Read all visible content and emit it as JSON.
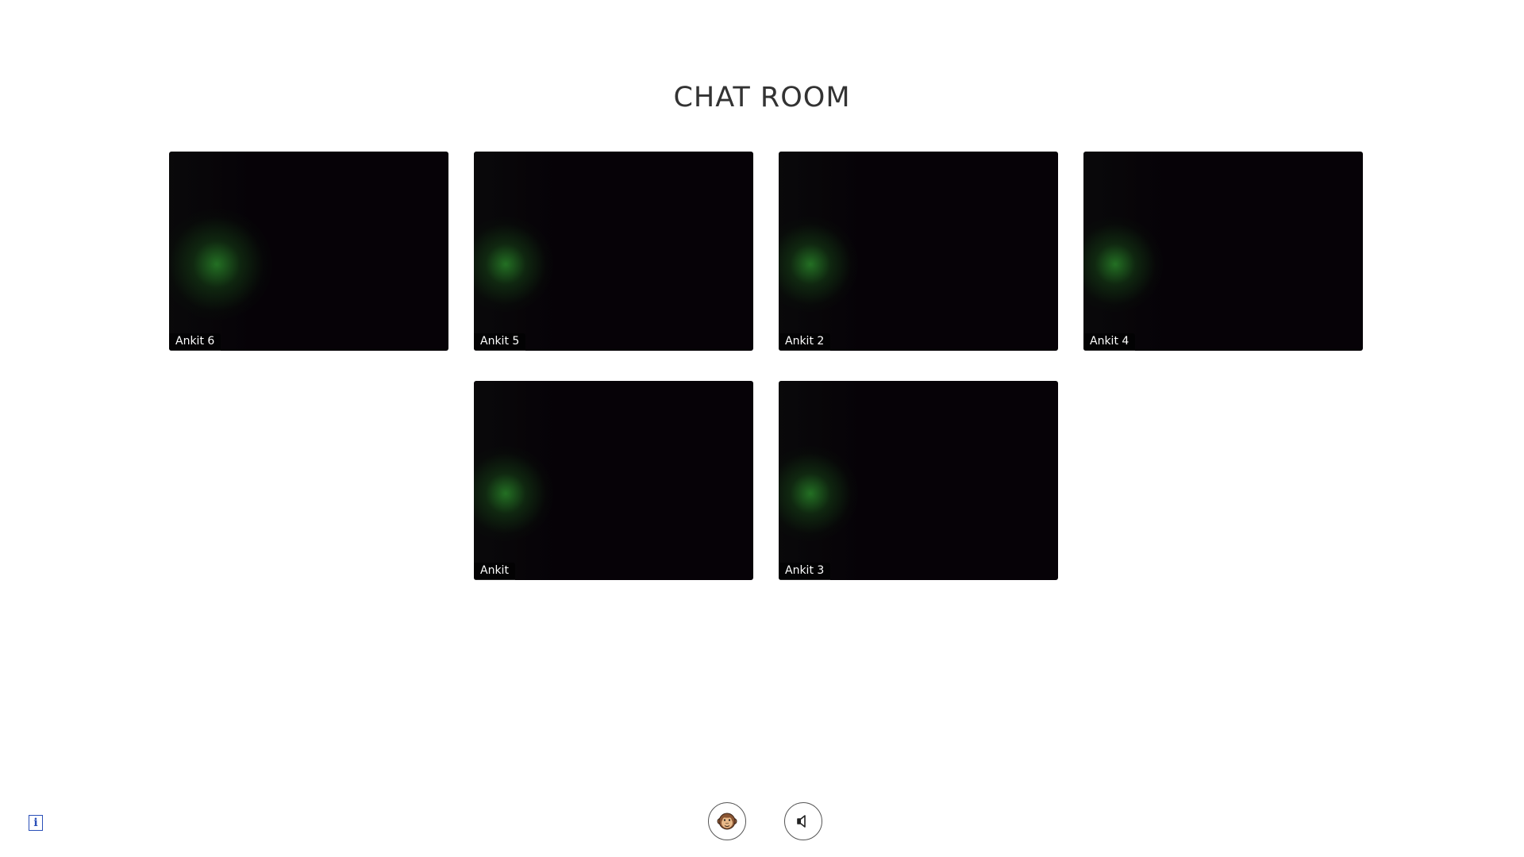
{
  "page": {
    "title": "CHAT ROOM"
  },
  "participants": [
    {
      "name": "Ankit 6"
    },
    {
      "name": "Ankit 5"
    },
    {
      "name": "Ankit 2"
    },
    {
      "name": "Ankit 4"
    },
    {
      "name": "Ankit"
    },
    {
      "name": "Ankit 3"
    }
  ],
  "controls": {
    "mute_video_icon": "monkey-face-icon",
    "mute_audio_icon": "speaker-icon",
    "info_label": "i"
  },
  "colors": {
    "video_background": "#060207",
    "video_glow": "#2a8a2a",
    "info_accent": "#2a4fb8"
  }
}
